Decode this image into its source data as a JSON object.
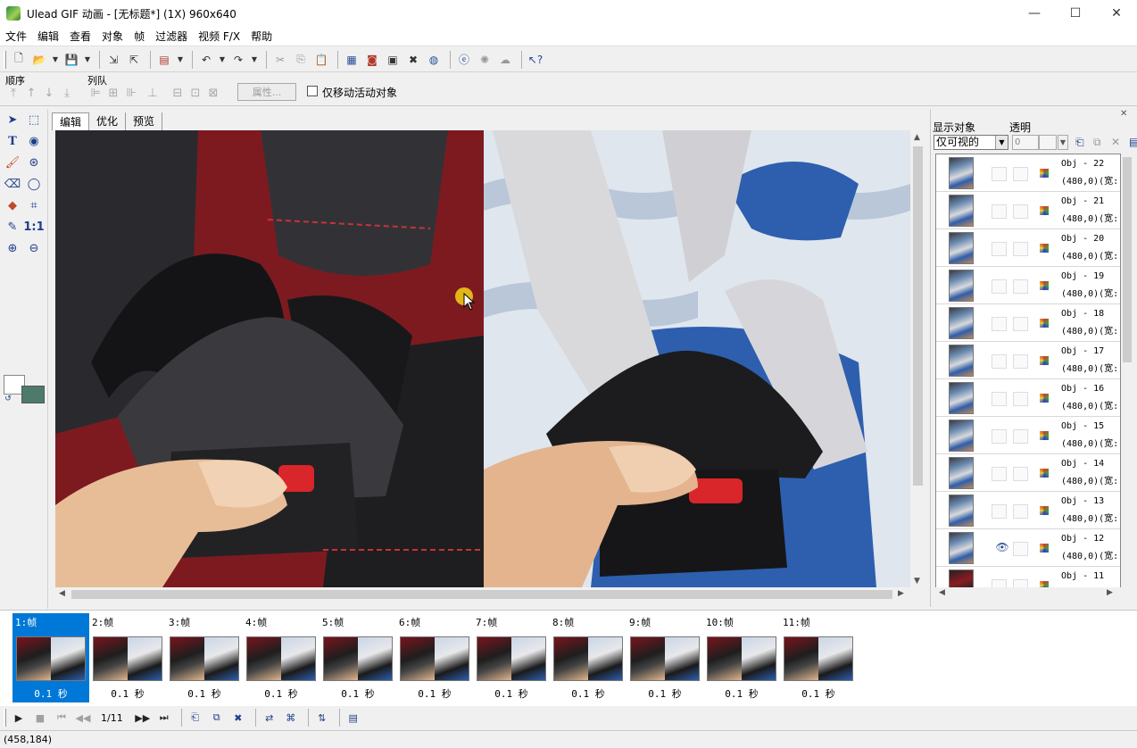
{
  "window": {
    "title": "Ulead GIF 动画 - [无标题*] (1X) 960x640",
    "minimize": "—",
    "maximize": "☐",
    "close": "✕"
  },
  "menu": [
    "文件",
    "编辑",
    "查看",
    "对象",
    "帧",
    "过滤器",
    "视频 F/X",
    "帮助"
  ],
  "toolbar2": {
    "order_label": "顺序",
    "align_label": "列队",
    "properties_button": "属性...",
    "move_active_only_label": "仅移动活动对象"
  },
  "tabs": [
    "编辑",
    "优化",
    "预览"
  ],
  "object_panel": {
    "show_label": "显示对象",
    "show_value": "仅可视的",
    "opacity_label": "透明",
    "opacity_value": "0",
    "objects": [
      {
        "name": "Obj - 22",
        "pos": "(480,0)(宽:"
      },
      {
        "name": "Obj - 21",
        "pos": "(480,0)(宽:"
      },
      {
        "name": "Obj - 20",
        "pos": "(480,0)(宽:"
      },
      {
        "name": "Obj - 19",
        "pos": "(480,0)(宽:"
      },
      {
        "name": "Obj - 18",
        "pos": "(480,0)(宽:"
      },
      {
        "name": "Obj - 17",
        "pos": "(480,0)(宽:"
      },
      {
        "name": "Obj - 16",
        "pos": "(480,0)(宽:"
      },
      {
        "name": "Obj - 15",
        "pos": "(480,0)(宽:"
      },
      {
        "name": "Obj - 14",
        "pos": "(480,0)(宽:"
      },
      {
        "name": "Obj - 13",
        "pos": "(480,0)(宽:"
      },
      {
        "name": "Obj - 12",
        "pos": "(480,0)(宽:",
        "visible": true
      },
      {
        "name": "Obj - 11",
        "pos": ""
      }
    ]
  },
  "frames": [
    {
      "label": "1:帧",
      "delay": "0.1 秒",
      "selected": true
    },
    {
      "label": "2:帧",
      "delay": "0.1 秒"
    },
    {
      "label": "3:帧",
      "delay": "0.1 秒"
    },
    {
      "label": "4:帧",
      "delay": "0.1 秒"
    },
    {
      "label": "5:帧",
      "delay": "0.1 秒"
    },
    {
      "label": "6:帧",
      "delay": "0.1 秒"
    },
    {
      "label": "7:帧",
      "delay": "0.1 秒"
    },
    {
      "label": "8:帧",
      "delay": "0.1 秒"
    },
    {
      "label": "9:帧",
      "delay": "0.1 秒"
    },
    {
      "label": "10:帧",
      "delay": "0.1 秒"
    },
    {
      "label": "11:帧",
      "delay": "0.1 秒"
    }
  ],
  "playback": {
    "frame_counter": "1/11"
  },
  "status": {
    "coordinates": "(458,184)"
  },
  "colors": {
    "selection": "#0078d7",
    "background_swatch": "#4e7a6c"
  }
}
